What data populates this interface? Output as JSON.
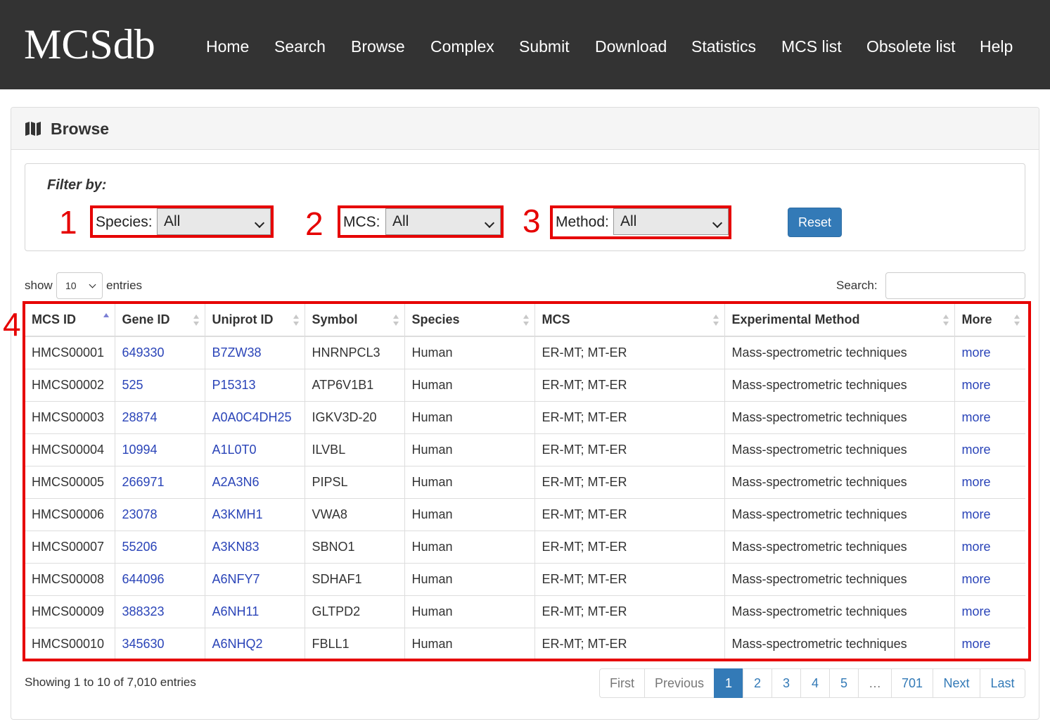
{
  "brand": "MCSdb",
  "nav": [
    "Home",
    "Search",
    "Browse",
    "Complex",
    "Submit",
    "Download",
    "Statistics",
    "MCS list",
    "Obsolete list",
    "Help"
  ],
  "panel": {
    "title": "Browse",
    "icon": "map-icon"
  },
  "filter": {
    "heading": "Filter by:",
    "species": {
      "number": "1",
      "label": "Species:",
      "value": "All"
    },
    "mcs": {
      "number": "2",
      "label": "MCS:",
      "value": "All"
    },
    "method": {
      "number": "3",
      "label": "Method:",
      "value": "All"
    },
    "reset_label": "Reset"
  },
  "table_marker": "4",
  "length": {
    "show": "show",
    "value": "10",
    "entries": "entries"
  },
  "search": {
    "label": "Search:",
    "value": ""
  },
  "columns": [
    "MCS ID",
    "Gene ID",
    "Uniprot ID",
    "Symbol",
    "Species",
    "MCS",
    "Experimental Method",
    "More"
  ],
  "rows": [
    [
      "HMCS00001",
      "649330",
      "B7ZW38",
      "HNRNPCL3",
      "Human",
      "ER-MT; MT-ER",
      "Mass-spectrometric techniques",
      "more"
    ],
    [
      "HMCS00002",
      "525",
      "P15313",
      "ATP6V1B1",
      "Human",
      "ER-MT; MT-ER",
      "Mass-spectrometric techniques",
      "more"
    ],
    [
      "HMCS00003",
      "28874",
      "A0A0C4DH25",
      "IGKV3D-20",
      "Human",
      "ER-MT; MT-ER",
      "Mass-spectrometric techniques",
      "more"
    ],
    [
      "HMCS00004",
      "10994",
      "A1L0T0",
      "ILVBL",
      "Human",
      "ER-MT; MT-ER",
      "Mass-spectrometric techniques",
      "more"
    ],
    [
      "HMCS00005",
      "266971",
      "A2A3N6",
      "PIPSL",
      "Human",
      "ER-MT; MT-ER",
      "Mass-spectrometric techniques",
      "more"
    ],
    [
      "HMCS00006",
      "23078",
      "A3KMH1",
      "VWA8",
      "Human",
      "ER-MT; MT-ER",
      "Mass-spectrometric techniques",
      "more"
    ],
    [
      "HMCS00007",
      "55206",
      "A3KN83",
      "SBNO1",
      "Human",
      "ER-MT; MT-ER",
      "Mass-spectrometric techniques",
      "more"
    ],
    [
      "HMCS00008",
      "644096",
      "A6NFY7",
      "SDHAF1",
      "Human",
      "ER-MT; MT-ER",
      "Mass-spectrometric techniques",
      "more"
    ],
    [
      "HMCS00009",
      "388323",
      "A6NH11",
      "GLTPD2",
      "Human",
      "ER-MT; MT-ER",
      "Mass-spectrometric techniques",
      "more"
    ],
    [
      "HMCS00010",
      "345630",
      "A6NHQ2",
      "FBLL1",
      "Human",
      "ER-MT; MT-ER",
      "Mass-spectrometric techniques",
      "more"
    ]
  ],
  "info": "Showing 1 to 10 of 7,010 entries",
  "pagination": {
    "first": "First",
    "previous": "Previous",
    "pages": [
      "1",
      "2",
      "3",
      "4",
      "5",
      "…",
      "701"
    ],
    "next": "Next",
    "last": "Last",
    "active": "1"
  },
  "colors": {
    "navbar": "#333333",
    "link": "#2a44b8",
    "annotation_red": "#e60000",
    "button_blue": "#337ab7"
  }
}
